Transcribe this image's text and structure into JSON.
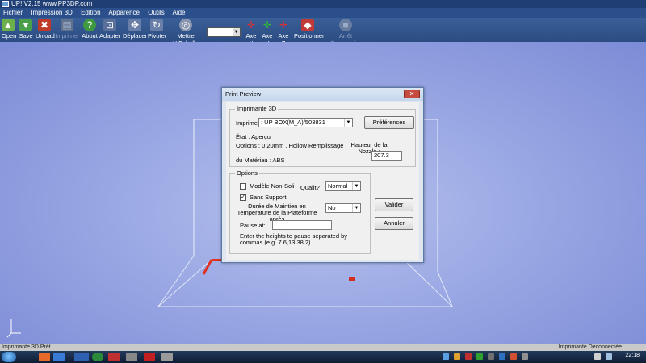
{
  "window": {
    "title": "UP!  V2.15  www.PP3DP.com"
  },
  "menu": [
    "Fichier",
    "Impression 3D",
    "Edition",
    "Apparence",
    "Outils",
    "Aide"
  ],
  "toolbar": {
    "open": "Open",
    "save": "Save",
    "unload": "Unload",
    "imprimer": "Imprimer",
    "about": "About",
    "adapter": "Adapter",
    "deplacer": "Déplacer",
    "pivoter": "Pivoter",
    "mettre_echelle": "Mettre Y/Echelle",
    "axe_x": "Axe X",
    "axe_y": "Axe Y",
    "axe_z": "Axe Z",
    "positionner": "Positionner",
    "arret": "Arrêt d'Impression"
  },
  "dialog": {
    "title": "Print Preview",
    "close_glyph": "✕",
    "imprimante_group": "Imprimante 3D",
    "imprime_label": "Imprime",
    "printer_value": ": UP BOX(M_A)/503831",
    "preferences_button": "Préférences",
    "etat": "État : Aperçu",
    "options_line": "Options : 0.20mm , Hollow Remplissage",
    "hauteur_label": "Hauteur de la Nozzle :",
    "hauteur_value": "207.3",
    "materiau": "du Matériau : ABS",
    "options_group": "Options",
    "modele_non_solide": "Modèle Non-Soli",
    "qualite_label": "Qualit?",
    "qualite_value": "Normal",
    "sans_support": "Sans Support",
    "duree_label": "Durée de Maintien en Température de la Plateforme après",
    "duree_value": "No",
    "pause_label": "Pause at:",
    "pause_value": "",
    "pause_help": "Enter the heights to pause separated by commas (e.g. 7.6,13,38.2)",
    "valider_button": "Valider",
    "annuler_button": "Annuler"
  },
  "status": {
    "left": "Imprimante 3D  Prêt",
    "right": "Imprimante Déconnectée"
  },
  "taskbar": {
    "time": "22:18"
  },
  "colors": {
    "titlebar": "#1f3e73",
    "toolbar": "#2b4c82",
    "viewport": "#9aa8e4",
    "platform_edge": "#e03020"
  }
}
